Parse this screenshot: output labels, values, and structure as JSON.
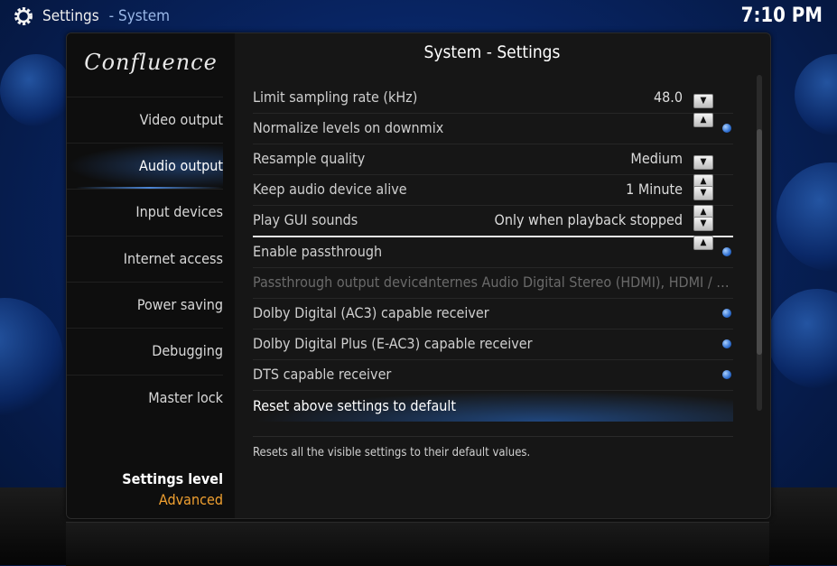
{
  "header": {
    "section": "Settings",
    "subsection": "System",
    "clock": "7:10 PM"
  },
  "sidebar": {
    "logo": "Confluence",
    "items": [
      {
        "label": "Video output",
        "active": false
      },
      {
        "label": "Audio output",
        "active": true
      },
      {
        "label": "Input devices",
        "active": false
      },
      {
        "label": "Internet access",
        "active": false
      },
      {
        "label": "Power saving",
        "active": false
      },
      {
        "label": "Debugging",
        "active": false
      },
      {
        "label": "Master lock",
        "active": false
      }
    ],
    "settings_level_label": "Settings level",
    "settings_level_value": "Advanced"
  },
  "content": {
    "title": "System - Settings",
    "settings": [
      {
        "label": "Limit sampling rate (kHz)",
        "value": "48.0",
        "control": "spinner"
      },
      {
        "label": "Normalize levels on downmix",
        "value": "",
        "control": "radio"
      },
      {
        "label": "Resample quality",
        "value": "Medium",
        "control": "spinner"
      },
      {
        "label": "Keep audio device alive",
        "value": "1 Minute",
        "control": "spinner"
      },
      {
        "label": "Play GUI sounds",
        "value": "Only when playback stopped",
        "control": "spinner"
      },
      {
        "label": "Enable passthrough",
        "value": "",
        "control": "radio"
      },
      {
        "label": "Passthrough output device",
        "value": "Internes Audio Digital Stereo (HDMI), HDMI / Displa...",
        "control": "disabled"
      },
      {
        "label": "Dolby Digital (AC3) capable receiver",
        "value": "",
        "control": "radio"
      },
      {
        "label": "Dolby Digital Plus (E-AC3) capable receiver",
        "value": "",
        "control": "radio"
      },
      {
        "label": "DTS capable receiver",
        "value": "",
        "control": "radio"
      }
    ],
    "reset_label": "Reset above settings to default",
    "description": "Resets all the visible settings to their default values."
  },
  "spinner": {
    "down": "▼",
    "up": "▲"
  },
  "colors": {
    "accent": "#f0a030",
    "radio": "#2f6fd0",
    "background": "#082462"
  }
}
